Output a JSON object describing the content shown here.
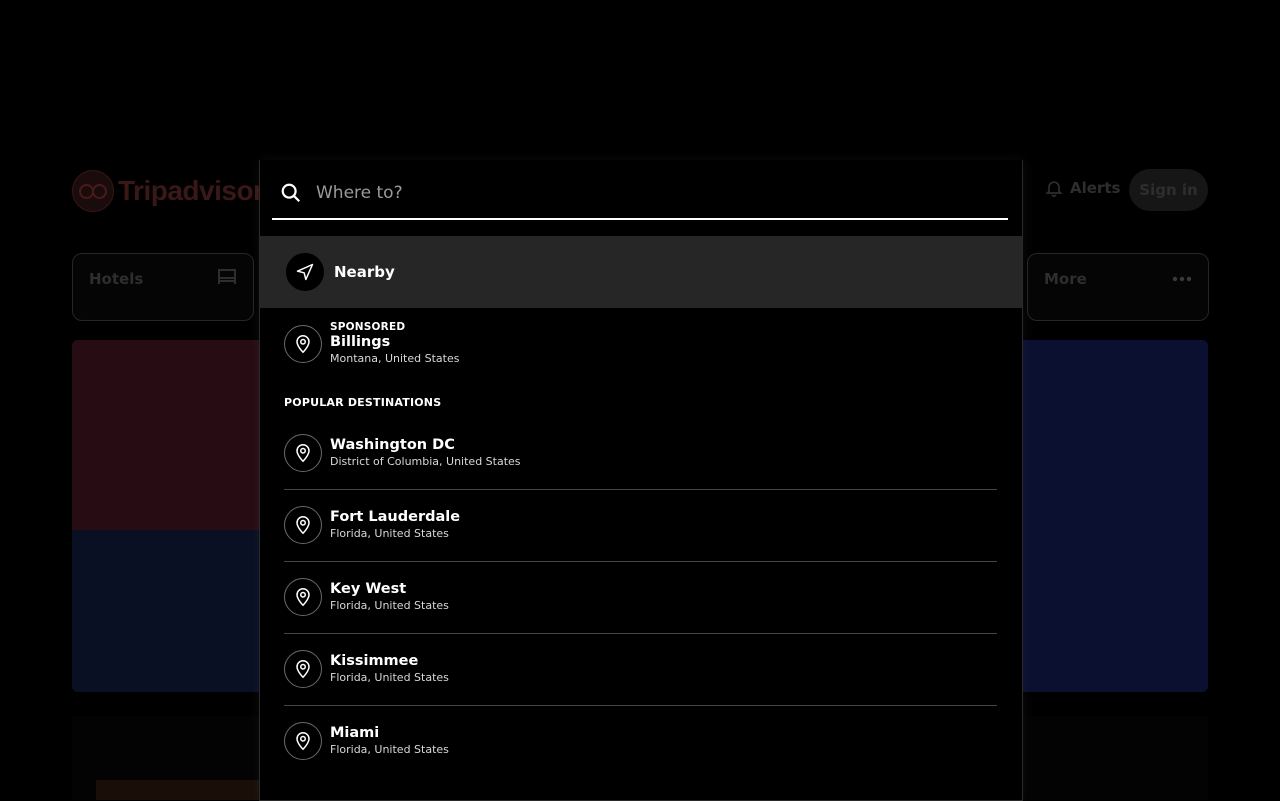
{
  "header": {
    "logo_text": "Tripadvisor",
    "alerts_label": "Alerts",
    "signin_label": "Sign in"
  },
  "categories": [
    {
      "label": "Hotels",
      "icon": "bed-icon"
    },
    {
      "label": "More",
      "icon": "more-icon"
    }
  ],
  "search": {
    "placeholder": "Where to?",
    "value": ""
  },
  "nearby": {
    "label": "Nearby",
    "icon": "navigation-arrow-icon"
  },
  "sponsored": {
    "tag": "SPONSORED",
    "name": "Billings",
    "location": "Montana, United States"
  },
  "popular": {
    "section_title": "POPULAR DESTINATIONS",
    "items": [
      {
        "name": "Washington DC",
        "location": "District of Columbia, United States"
      },
      {
        "name": "Fort Lauderdale",
        "location": "Florida, United States"
      },
      {
        "name": "Key West",
        "location": "Florida, United States"
      },
      {
        "name": "Kissimmee",
        "location": "Florida, United States"
      },
      {
        "name": "Miami",
        "location": "Florida, United States"
      }
    ]
  },
  "colors": {
    "overlay_bg": "#000000",
    "nearby_bg": "#262626",
    "text": "#ffffff"
  }
}
